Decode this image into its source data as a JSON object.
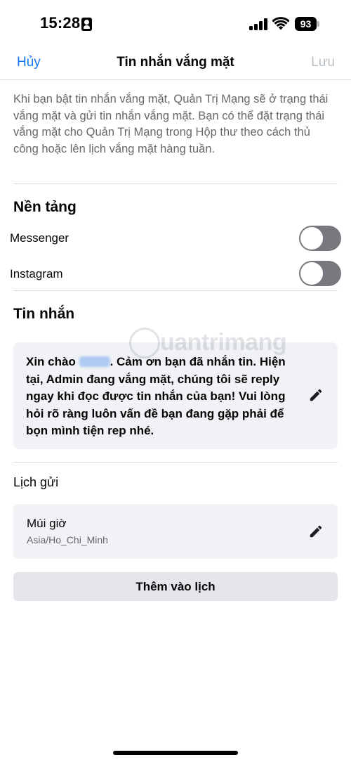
{
  "status_bar": {
    "time": "15:28",
    "battery": "93"
  },
  "nav": {
    "cancel_label": "Hủy",
    "title": "Tin nhắn vắng mặt",
    "save_label": "Lưu"
  },
  "intro_text": "Khi bạn bật tin nhắn vắng mặt, Quản Trị Mạng sẽ ở trạng thái vắng mặt và gửi tin nhắn vắng mặt. Bạn có thể đặt trạng thái vắng mặt cho Quản Trị Mạng trong Hộp thư theo cách thủ công hoặc lên lịch vắng mặt hàng tuần.",
  "platforms": {
    "title": "Nền tảng",
    "items": [
      {
        "label": "Messenger",
        "enabled": false
      },
      {
        "label": "Instagram",
        "enabled": false
      }
    ]
  },
  "message": {
    "title": "Tin nhắn",
    "greeting": "Xin chào ",
    "body": ". Cảm ơn bạn đã nhắn tin. Hiện tại, Admin đang vắng mặt, chúng tôi sẽ reply ngay khi đọc được tin nhắn của bạn! Vui lòng hỏi rõ ràng luôn vấn đề bạn đang gặp phải để bọn mình tiện rep nhé."
  },
  "schedule": {
    "title": "Lịch gửi",
    "timezone_label": "Múi giờ",
    "timezone_value": "Asia/Ho_Chi_Minh",
    "add_button_label": "Thêm vào lịch"
  },
  "watermark": {
    "text": "uantrimang"
  },
  "colors": {
    "accent": "#1877f2",
    "save_disabled": "#b9c0c8",
    "card_bg": "#f0f2f5",
    "button_bg": "#e4e6eb",
    "toggle_off": "#78787e",
    "secondary_text": "#65676b"
  },
  "icons": {
    "edit": "pencil-icon",
    "id_card": "person-card-icon",
    "signal": "cellular-signal-icon",
    "wifi": "wifi-icon",
    "battery": "battery-icon"
  }
}
